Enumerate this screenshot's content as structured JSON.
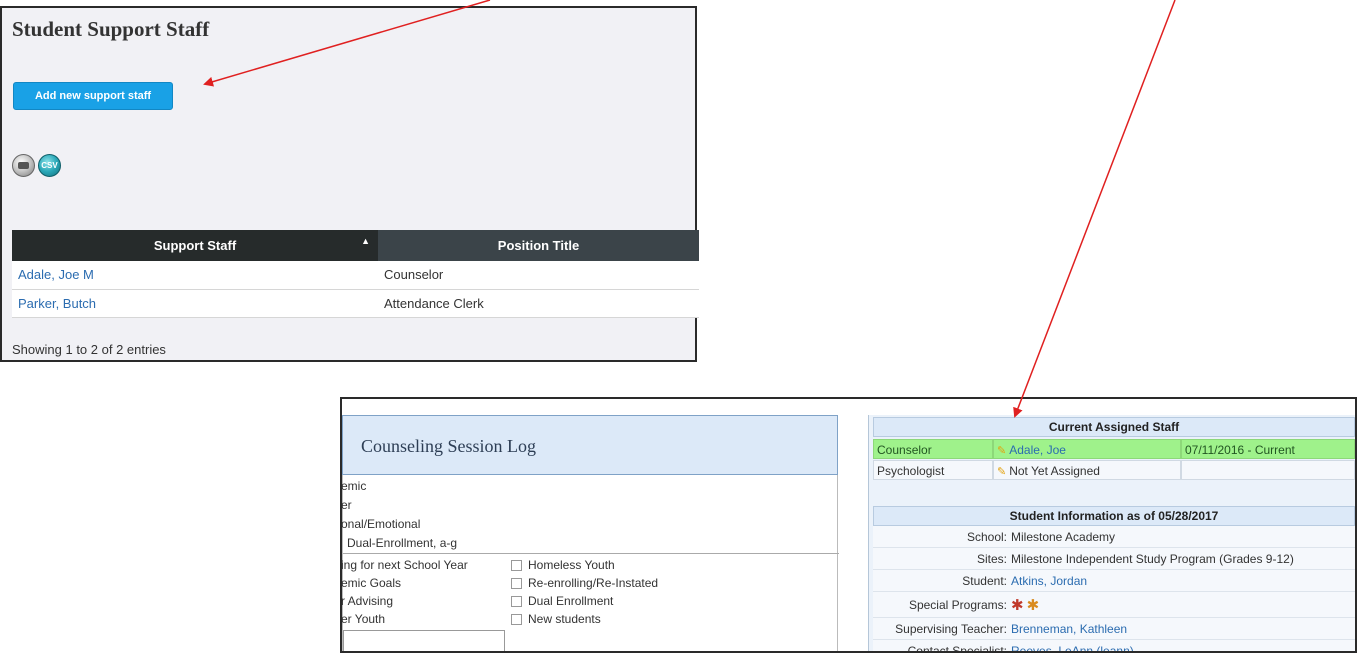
{
  "support_staff_panel": {
    "title": "Student Support Staff",
    "add_button_label": "Add new support staff",
    "icons": {
      "print": "print-icon",
      "csv_label": "CSV"
    },
    "table": {
      "headers": [
        "Support Staff",
        "Position Title"
      ],
      "rows": [
        {
          "name": "Adale, Joe M",
          "position": "Counselor"
        },
        {
          "name": "Parker, Butch",
          "position": "Attendance Clerk"
        }
      ]
    },
    "footer": "Showing 1 to 2 of 2 entries"
  },
  "counseling_panel": {
    "title": "Counseling Session Log",
    "categories": [
      "emic",
      "er",
      "onal/Emotional",
      "Dual-Enrollment, a-g"
    ],
    "left_checks": [
      "ing for next School Year",
      "emic Goals",
      "r Advising",
      "er Youth"
    ],
    "right_checks": [
      "Homeless Youth",
      "Re-enrolling/Re-Instated",
      "Dual Enrollment",
      "New students"
    ]
  },
  "assigned_staff": {
    "header": "Current Assigned Staff",
    "rows": [
      {
        "role": "Counselor",
        "name": "Adale, Joe",
        "dates": "07/11/2016 - Current"
      },
      {
        "role": "Psychologist",
        "name": "Not Yet Assigned",
        "dates": ""
      }
    ]
  },
  "student_info": {
    "header": "Student Information as of 05/28/2017",
    "rows": [
      {
        "label": "School:",
        "value": "Milestone Academy"
      },
      {
        "label": "Sites:",
        "value": "Milestone Independent Study Program (Grades 9-12)"
      },
      {
        "label": "Student:",
        "value": "Atkins, Jordan"
      },
      {
        "label": "Special Programs:",
        "value": ""
      },
      {
        "label": "Supervising Teacher:",
        "value": "Brenneman, Kathleen"
      },
      {
        "label": "Contact Specialist:",
        "value": "Reeves, LeAnn (leann)"
      }
    ]
  },
  "colors": {
    "button_blue": "#19a1e6",
    "header_dark": "#262b2b",
    "header_slate": "#3b4449",
    "highlight_green": "#9ff28b",
    "annotation_red": "#e02020"
  }
}
